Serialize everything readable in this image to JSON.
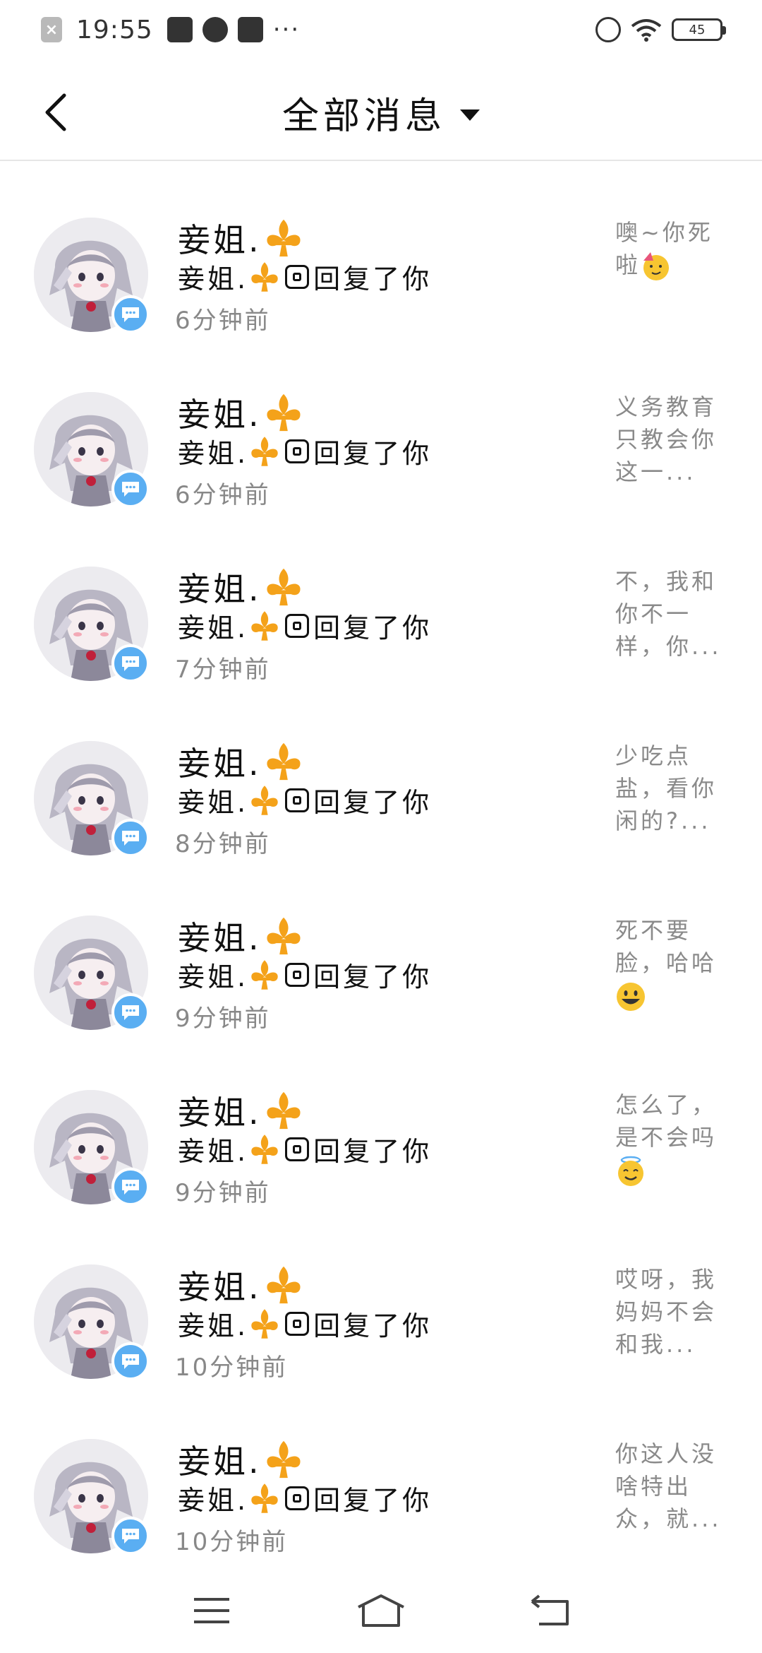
{
  "status_bar": {
    "time": "19:55",
    "battery": "45",
    "more": "···"
  },
  "header": {
    "title": "全部消息"
  },
  "messages": [
    {
      "name": "妾姐.",
      "reply_label": "回复了你",
      "time": "6分钟前",
      "preview": "噢~你死啦",
      "emoji": "party-face"
    },
    {
      "name": "妾姐.",
      "reply_label": "回复了你",
      "time": "6分钟前",
      "preview": "义务教育只教会你这一...",
      "emoji": ""
    },
    {
      "name": "妾姐.",
      "reply_label": "回复了你",
      "time": "7分钟前",
      "preview": "不，我和你不一样，你...",
      "emoji": ""
    },
    {
      "name": "妾姐.",
      "reply_label": "回复了你",
      "time": "8分钟前",
      "preview": "少吃点盐，看你闲的?...",
      "emoji": ""
    },
    {
      "name": "妾姐.",
      "reply_label": "回复了你",
      "time": "9分钟前",
      "preview": "死不要脸，哈哈",
      "emoji": "grin-face"
    },
    {
      "name": "妾姐.",
      "reply_label": "回复了你",
      "time": "9分钟前",
      "preview": "怎么了，是不会吗",
      "emoji": "halo-face"
    },
    {
      "name": "妾姐.",
      "reply_label": "回复了你",
      "time": "10分钟前",
      "preview": "哎呀，我妈妈不会和我...",
      "emoji": ""
    },
    {
      "name": "妾姐.",
      "reply_label": "回复了你",
      "time": "10分钟前",
      "preview": "你这人没啥特出众，就...",
      "emoji": ""
    }
  ],
  "colors": {
    "badge": "#5aaef2",
    "fleur": "#f4a21a",
    "divider": "#e6e6e6"
  }
}
